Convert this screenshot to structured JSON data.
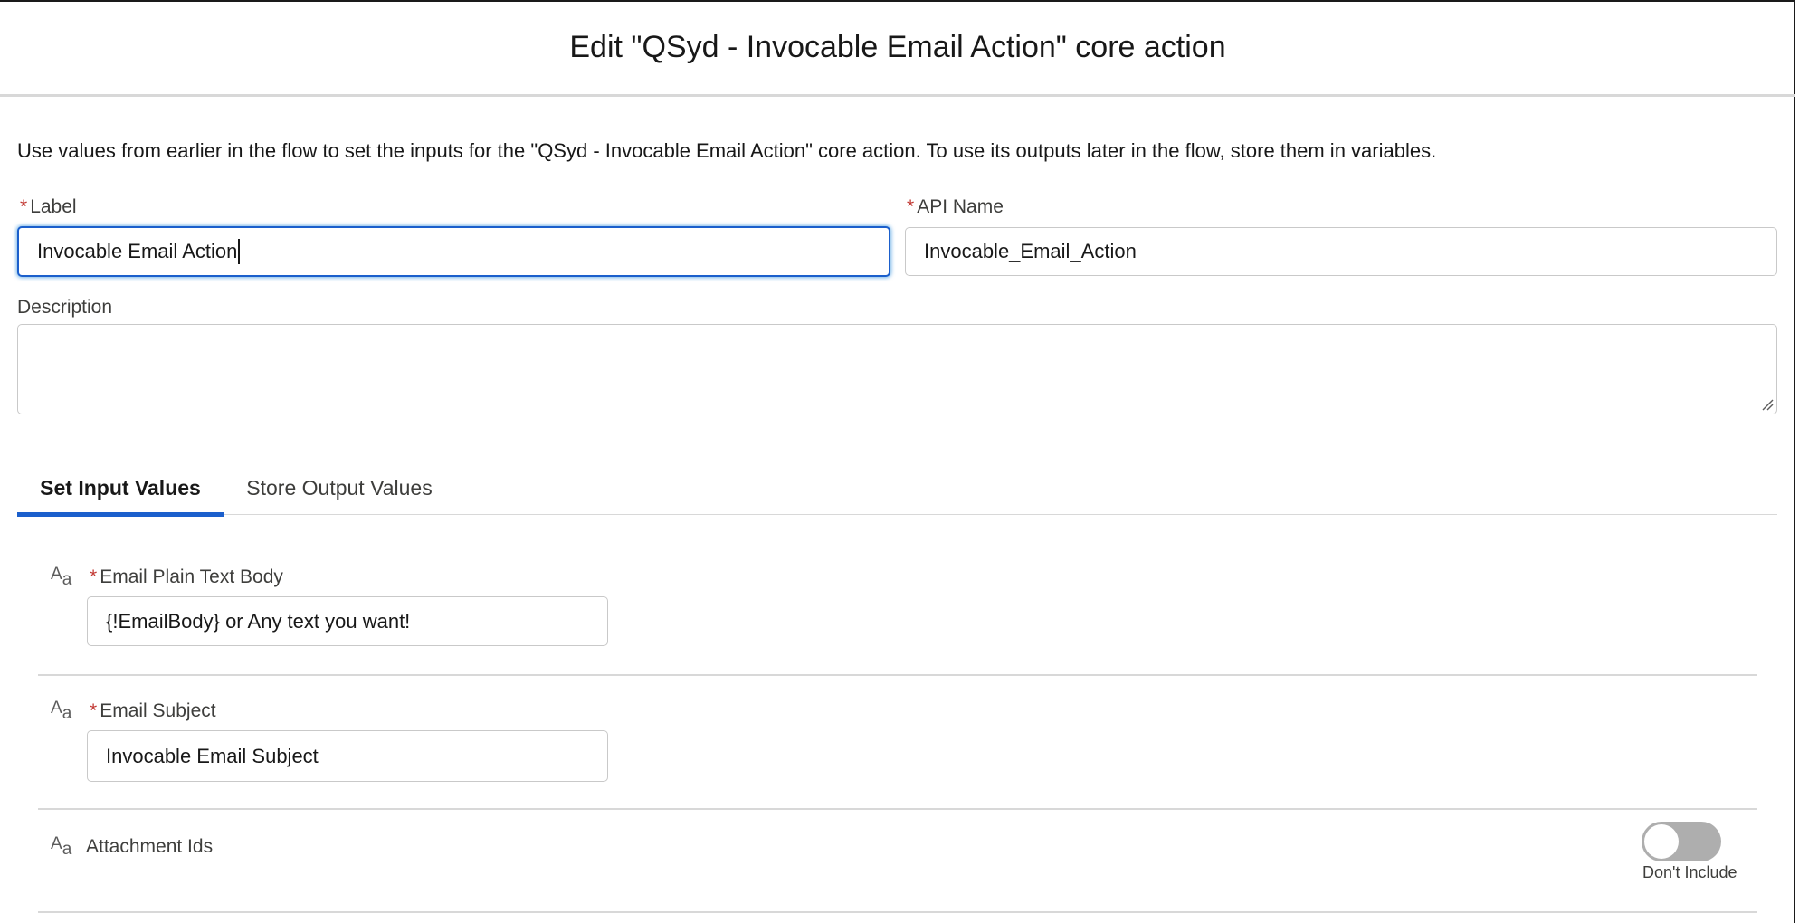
{
  "header": {
    "title": "Edit \"QSyd - Invocable Email Action\" core action"
  },
  "intro_text": "Use values from earlier in the flow to set the inputs for the \"QSyd - Invocable Email Action\" core action. To use its outputs later in the flow, store them in variables.",
  "form": {
    "label": {
      "label": "Label",
      "value": "Invocable Email Action"
    },
    "api_name": {
      "label": "API Name",
      "value": "Invocable_Email_Action"
    },
    "description": {
      "label": "Description",
      "value": ""
    }
  },
  "tabs": [
    {
      "label": "Set Input Values",
      "active": true
    },
    {
      "label": "Store Output Values",
      "active": false
    }
  ],
  "inputs": [
    {
      "icon": "text-type-icon",
      "label": "Email Plain Text Body",
      "required": true,
      "value": "{!EmailBody} or Any text you want!"
    },
    {
      "icon": "text-type-icon",
      "label": "Email Subject",
      "required": true,
      "value": "Invocable Email Subject"
    },
    {
      "icon": "text-type-icon",
      "label": "Attachment Ids",
      "required": false,
      "toggle_label": "Don't Include",
      "included": false
    }
  ],
  "required_marker": "*",
  "icon_glyph": {
    "upper": "A",
    "lower": "a"
  },
  "colors": {
    "focus_border": "#1b5fcc",
    "active_tab_underline": "#1b5fcc",
    "required_asterisk": "#c23934",
    "toggle_off": "#aeaeae"
  }
}
